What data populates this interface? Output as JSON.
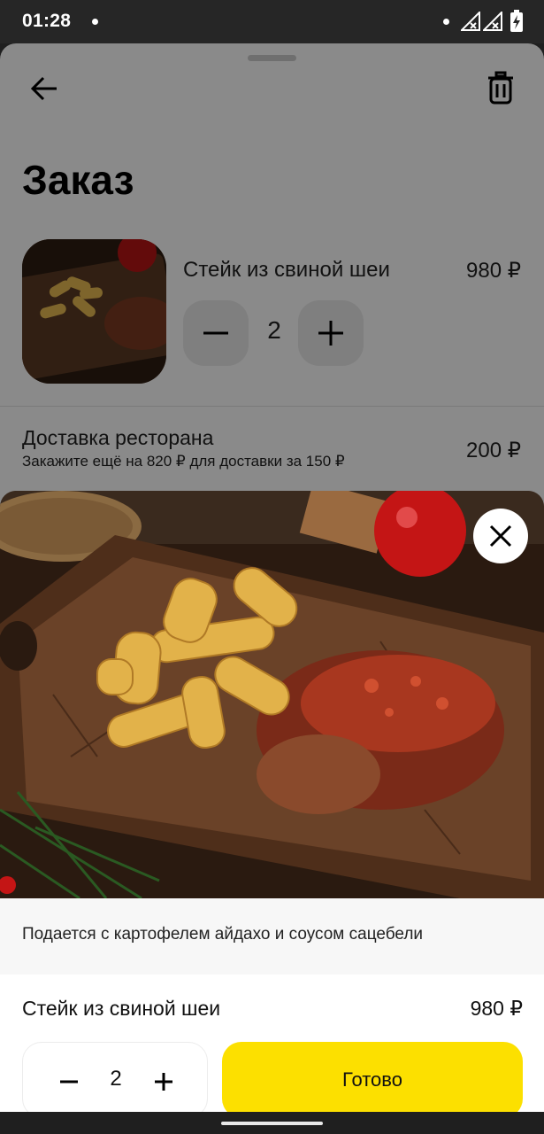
{
  "status_bar": {
    "time": "01:28"
  },
  "cart": {
    "title": "Заказ",
    "item": {
      "name": "Стейк из свиной шеи",
      "price": "980 ₽",
      "quantity": "2"
    },
    "delivery": {
      "title": "Доставка ресторана",
      "subtitle": "Закажите ещё на 820 ₽ для доставки за 150 ₽",
      "price": "200 ₽"
    }
  },
  "modal": {
    "description": "Подается с картофелем айдахо и соусом сацебели",
    "item_name": "Стейк из свиной шеи",
    "price": "980 ₽",
    "quantity": "2",
    "done_label": "Готово"
  },
  "colors": {
    "accent": "#fce000",
    "overlay": "#8a8a8a"
  },
  "icons": [
    "back-arrow-icon",
    "trash-icon",
    "minus-icon",
    "plus-icon",
    "close-icon",
    "signal-icon",
    "battery-icon"
  ]
}
